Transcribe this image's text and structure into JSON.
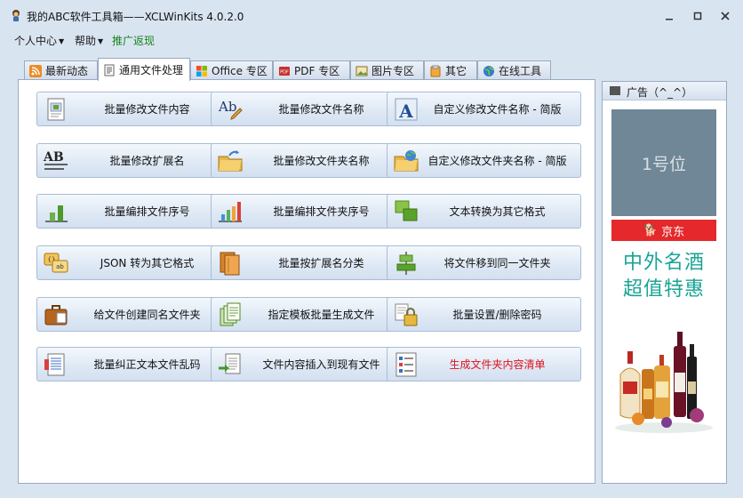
{
  "window": {
    "title": "我的ABC软件工具箱——XCLWinKits  4.0.2.0",
    "controls": {
      "minimize": "—",
      "maximize": "□",
      "close": "✕"
    }
  },
  "menu": [
    {
      "label": "个人中心",
      "has_dropdown": true
    },
    {
      "label": "帮助",
      "has_dropdown": true
    },
    {
      "label": "推广返现",
      "has_dropdown": false,
      "color": "#16841a"
    }
  ],
  "tabs": [
    {
      "label": "最新动态",
      "icon": "rss-icon",
      "active": false
    },
    {
      "label": "通用文件处理",
      "icon": "document-icon",
      "active": true
    },
    {
      "label": "Office 专区",
      "icon": "office-icon",
      "active": false
    },
    {
      "label": "PDF 专区",
      "icon": "pdf-icon",
      "active": false
    },
    {
      "label": "图片专区",
      "icon": "picture-icon",
      "active": false
    },
    {
      "label": "其它",
      "icon": "other-icon",
      "active": false
    },
    {
      "label": "在线工具",
      "icon": "globe-icon",
      "active": false
    }
  ],
  "buttons": [
    {
      "label": "批量修改文件内容",
      "icon": "document-edit-icon"
    },
    {
      "label": "批量修改文件名称",
      "icon": "rename-pencil-icon"
    },
    {
      "label": "自定义修改文件名称 - 简版",
      "icon": "letter-a-icon"
    },
    {
      "label": "批量修改扩展名",
      "icon": "ab-text-icon"
    },
    {
      "label": "批量修改文件夹名称",
      "icon": "folder-arrow-icon"
    },
    {
      "label": "自定义修改文件夹名称 - 简版",
      "icon": "folder-globe-icon"
    },
    {
      "label": "批量编排文件序号",
      "icon": "bar-green-icon"
    },
    {
      "label": "批量编排文件夹序号",
      "icon": "bar-color-icon"
    },
    {
      "label": "文本转换为其它格式",
      "icon": "convert-green-icon"
    },
    {
      "label": "JSON 转为其它格式",
      "icon": "json-convert-icon"
    },
    {
      "label": "批量按扩展名分类",
      "icon": "books-icon"
    },
    {
      "label": "将文件移到同一文件夹",
      "icon": "align-move-icon"
    },
    {
      "label": "给文件创建同名文件夹",
      "icon": "briefcase-icon"
    },
    {
      "label": "指定模板批量生成文件",
      "icon": "template-pages-icon"
    },
    {
      "label": "批量设置/删除密码",
      "icon": "lock-icon"
    },
    {
      "label": "批量纠正文本文件乱码",
      "icon": "text-fix-icon"
    },
    {
      "label": "文件内容插入到现有文件",
      "icon": "insert-file-icon"
    },
    {
      "label": "生成文件夹内容清单",
      "icon": "checklist-icon",
      "color": "#e0121b"
    }
  ],
  "ad": {
    "header": "广告（^_^）",
    "slot1": "1号位",
    "brand": "京东",
    "slogan_line1": "中外名酒",
    "slogan_line2": "超值特惠"
  }
}
